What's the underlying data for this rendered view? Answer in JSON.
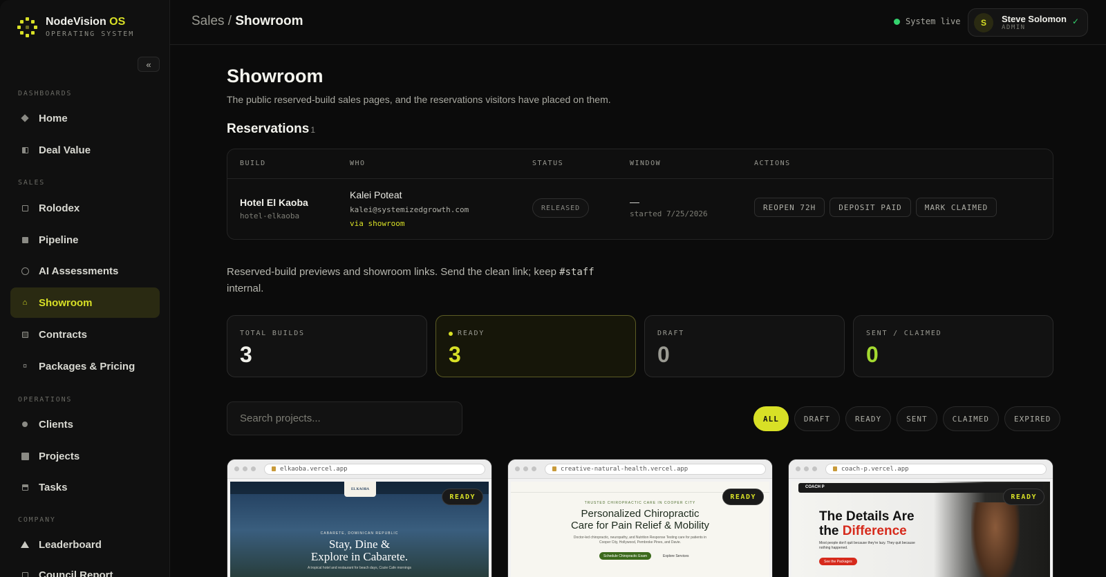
{
  "brand": {
    "name": "NodeVision",
    "name_accent": "OS",
    "subtitle": "OPERATING SYSTEM"
  },
  "sidebar": {
    "collapse_icon": "«",
    "sections": [
      {
        "title": "DASHBOARDS",
        "items": [
          {
            "label": "Home",
            "icon": "diamond-icon"
          },
          {
            "label": "Deal Value",
            "icon": "half-square-icon"
          }
        ]
      },
      {
        "title": "SALES",
        "items": [
          {
            "label": "Rolodex",
            "icon": "grid-icon"
          },
          {
            "label": "Pipeline",
            "icon": "list-icon"
          },
          {
            "label": "AI Assessments",
            "icon": "circle-icon"
          },
          {
            "label": "Showroom",
            "icon": "home-icon",
            "active": true
          },
          {
            "label": "Contracts",
            "icon": "doc-icon"
          },
          {
            "label": "Packages & Pricing",
            "icon": "package-icon"
          }
        ]
      },
      {
        "title": "OPERATIONS",
        "items": [
          {
            "label": "Clients",
            "icon": "dot-icon"
          },
          {
            "label": "Projects",
            "icon": "square-icon"
          },
          {
            "label": "Tasks",
            "icon": "task-icon"
          }
        ]
      },
      {
        "title": "COMPANY",
        "items": [
          {
            "label": "Leaderboard",
            "icon": "triangle-icon"
          },
          {
            "label": "Council Report",
            "icon": "report-icon"
          }
        ]
      }
    ]
  },
  "header": {
    "crumb_parent": "Sales /",
    "crumb_current": "Showroom",
    "system_status": "System live",
    "user": {
      "initial": "S",
      "name": "Steve Solomon",
      "role": "ADMIN"
    }
  },
  "page": {
    "title": "Showroom",
    "description": "The public reserved-build sales pages, and the reservations visitors have placed on them."
  },
  "reservations": {
    "title": "Reservations",
    "count": "1",
    "columns": [
      "BUILD",
      "WHO",
      "STATUS",
      "WINDOW",
      "ACTIONS"
    ],
    "rows": [
      {
        "build_name": "Hotel El Kaoba",
        "build_slug": "hotel-elkaoba",
        "who_name": "Kalei Poteat",
        "who_email": "kalei@systemizedgrowth.com",
        "who_via": "via showroom",
        "status": "RELEASED",
        "window_main": "—",
        "window_sub": "started 7/25/2026",
        "actions": [
          "REOPEN 72H",
          "DEPOSIT PAID",
          "MARK CLAIMED"
        ]
      }
    ]
  },
  "note": {
    "text_before": "Reserved-build previews and showroom links. Send the clean link; keep",
    "code": "#staff",
    "text_after": "internal."
  },
  "stats": [
    {
      "label": "TOTAL BUILDS",
      "value": "3",
      "color": "#f0f0ea"
    },
    {
      "label": "READY",
      "value": "3",
      "color": "#d8e026"
    },
    {
      "label": "DRAFT",
      "value": "0",
      "color": "#9a9a92"
    },
    {
      "label": "SENT / CLAIMED",
      "value": "0",
      "color": "#a3d930"
    }
  ],
  "search": {
    "placeholder": "Search projects..."
  },
  "filters": [
    "ALL",
    "DRAFT",
    "READY",
    "SENT",
    "CLAIMED",
    "EXPIRED"
  ],
  "projects": [
    {
      "url": "elkaoba.vercel.app",
      "status": "READY",
      "preview_logo": "EL KAOBA",
      "preview_kicker": "CABARETE, DOMINICAN REPUBLIC",
      "preview_headline_1": "Stay, Dine &",
      "preview_headline_2": "Explore in Cabarete.",
      "preview_sub": "A tropical hotel and restaurant for beach days, Cozie Cafe mornings"
    },
    {
      "url": "creative-natural-health.vercel.app",
      "status": "READY",
      "preview_kicker": "TRUSTED CHIROPRACTIC CARE IN COOPER CITY",
      "preview_headline_1": "Personalized Chiropractic",
      "preview_headline_2": "Care for Pain Relief & Mobility",
      "preview_sub": "Doctor-led chiropractic, neuropathy, and Nutrition Response Testing care for patients in Cooper City, Hollywood, Pembroke Pines, and Davie.",
      "preview_cta": "Schedule Chiropractic Exam",
      "preview_cta2": "Explore Services"
    },
    {
      "url": "coach-p.vercel.app",
      "status": "READY",
      "preview_brand": "COACH P",
      "preview_headline_1": "The Details Are",
      "preview_headline_2a": "the",
      "preview_headline_2b": "Difference",
      "preview_sub": "Most people don't quit because they're lazy. They quit because nothing happened.",
      "preview_cta": "See the Packages"
    }
  ]
}
